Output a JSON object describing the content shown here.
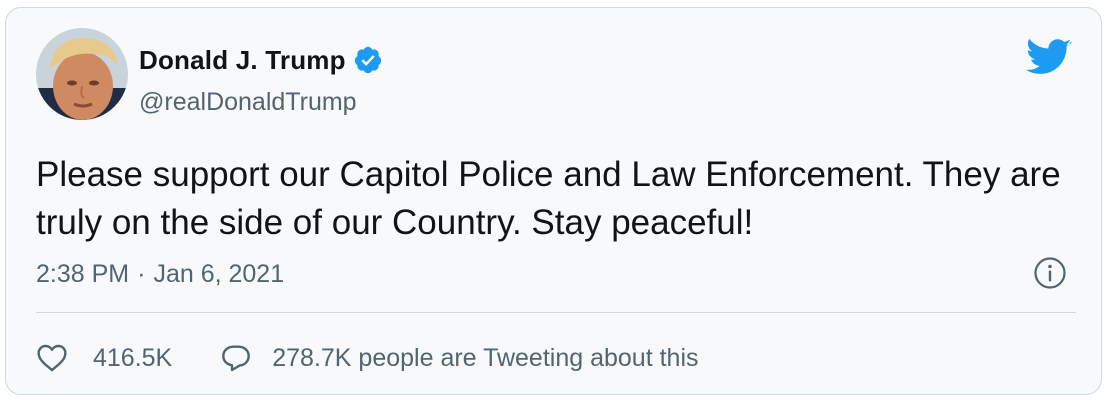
{
  "tweet": {
    "author": {
      "display_name": "Donald J. Trump",
      "handle": "@realDonaldTrump",
      "verified": true,
      "avatar_icon": "profile-photo"
    },
    "text": "Please support our Capitol Police and Law Enforcement. They are truly on the side of our Country. Stay peaceful!",
    "time": "2:38 PM",
    "separator": "·",
    "date": "Jan 6, 2021",
    "likes": "416.5K",
    "conversation": "278.7K people are Tweeting about this"
  },
  "icons": {
    "brand": "twitter-bird-icon",
    "verified": "verified-badge-icon",
    "info": "info-icon",
    "like": "heart-icon",
    "reply": "speech-bubble-icon"
  },
  "colors": {
    "brand_blue": "#1d9bf0",
    "text_primary": "#0f1419",
    "text_secondary": "#536471",
    "border": "#cfd9de",
    "card_bg": "#f7f9fa"
  }
}
